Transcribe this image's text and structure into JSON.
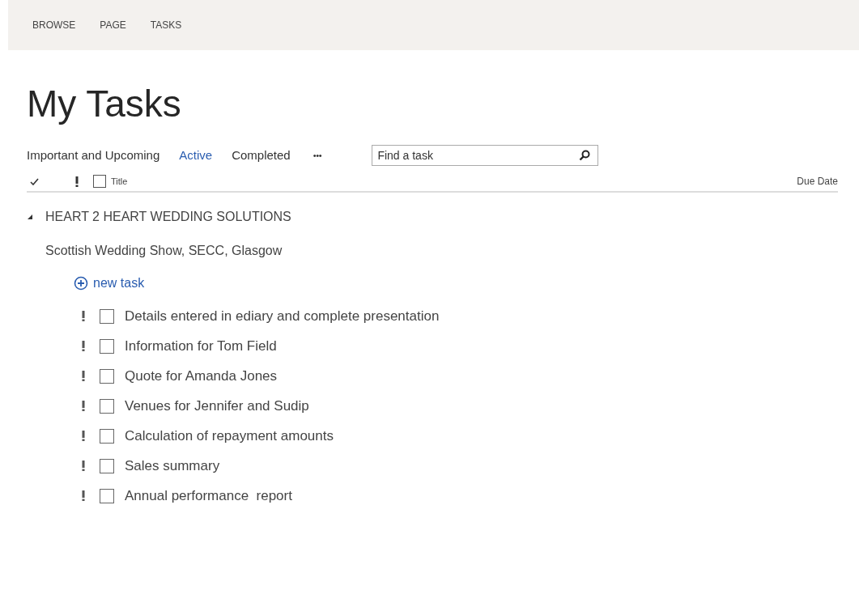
{
  "ribbon_tabs": [
    {
      "label": "BROWSE",
      "selected": false
    },
    {
      "label": "PAGE",
      "selected": false
    },
    {
      "label": "TASKS",
      "selected": false
    }
  ],
  "page_title": "My Tasks",
  "views": [
    {
      "label": "Important and Upcoming",
      "selected": false
    },
    {
      "label": "Active",
      "selected": true
    },
    {
      "label": "Completed",
      "selected": false
    }
  ],
  "more_views": "•••",
  "search": {
    "placeholder": "Find a task"
  },
  "columns": {
    "select_all_checked": false,
    "title": "Title",
    "due_date": "Due Date"
  },
  "group": {
    "name": "HEART 2 HEART WEDDING SOLUTIONS",
    "expanded": true,
    "subgroup": "Scottish Wedding Show, SECC, Glasgow",
    "new_task": "new task",
    "tasks": [
      {
        "title": "Details entered in ediary and complete presentation",
        "checked": false
      },
      {
        "title": "Information for Tom Field",
        "checked": false
      },
      {
        "title": "Quote for Amanda Jones",
        "checked": false
      },
      {
        "title": "Venues for Jennifer and Sudip",
        "checked": false
      },
      {
        "title": "Calculation of repayment amounts",
        "checked": false
      },
      {
        "title": "Sales summary",
        "checked": false
      },
      {
        "title": "Annual performance  report",
        "checked": false
      }
    ]
  }
}
